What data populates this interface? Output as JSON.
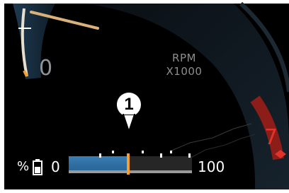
{
  "gauge": {
    "title": "RPM",
    "unit": "X1000",
    "left_value": "0",
    "redline_value": "7"
  },
  "callout": {
    "number": "1"
  },
  "charge_bar": {
    "percent_symbol": "%",
    "min_label": "0",
    "max_label": "100",
    "fill_fraction": 0.48,
    "colors": {
      "fill": "#3a7cb0",
      "marker": "#f2a033",
      "redline": "#e0342a"
    }
  },
  "icons": {
    "battery": "battery-icon"
  }
}
